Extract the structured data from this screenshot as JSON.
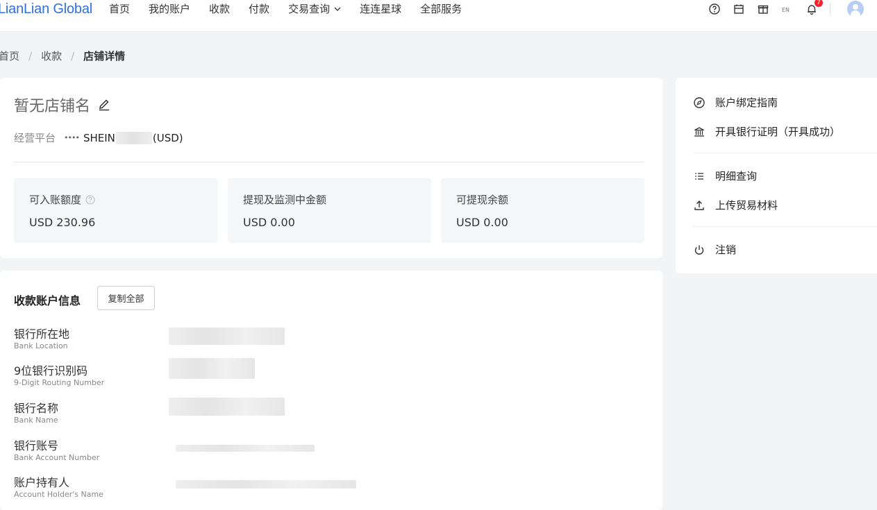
{
  "brand": {
    "logo_text": "LianLian Global",
    "accent": "#2f6fe0"
  },
  "nav": {
    "items": [
      "首页",
      "我的账户",
      "收款",
      "付款",
      "交易查询",
      "连连星球",
      "全部服务"
    ],
    "dropdown_item_index": 4
  },
  "top_icons": {
    "help": "help-icon",
    "calendar": "calendar-icon",
    "gift": "gift-icon",
    "language": "language-icon",
    "notifications": "bell-icon",
    "notification_count": "7"
  },
  "breadcrumb": {
    "home": "首页",
    "receive": "收款",
    "current": "店铺详情"
  },
  "store": {
    "name": "暂无店铺名",
    "platform_label": "经营平台",
    "platform_dots": "••••",
    "platform_name": "SHEIN",
    "platform_currency": "(USD)"
  },
  "stats": [
    {
      "label": "可入账额度",
      "value": "USD 230.96"
    },
    {
      "label": "提现及监测中金额",
      "value": "USD 0.00"
    },
    {
      "label": "可提现余额",
      "value": "USD 0.00"
    }
  ],
  "side_menu": {
    "bind_guide": "账户绑定指南",
    "bank_proof": "开具银行证明（开具成功）",
    "detail_query": "明细查询",
    "upload_trade": "上传贸易材料",
    "cancel": "注销"
  },
  "account_info": {
    "title": "收款账户信息",
    "copy_all": "复制全部",
    "fields": [
      {
        "zh": "银行所在地",
        "en": "Bank Location"
      },
      {
        "zh": "9位银行识别码",
        "en": "9-Digit Routing Number"
      },
      {
        "zh": "银行名称",
        "en": "Bank Name"
      },
      {
        "zh": "银行账号",
        "en": "Bank Account Number"
      },
      {
        "zh": "账户持有人",
        "en": "Account Holder's Name"
      }
    ]
  }
}
